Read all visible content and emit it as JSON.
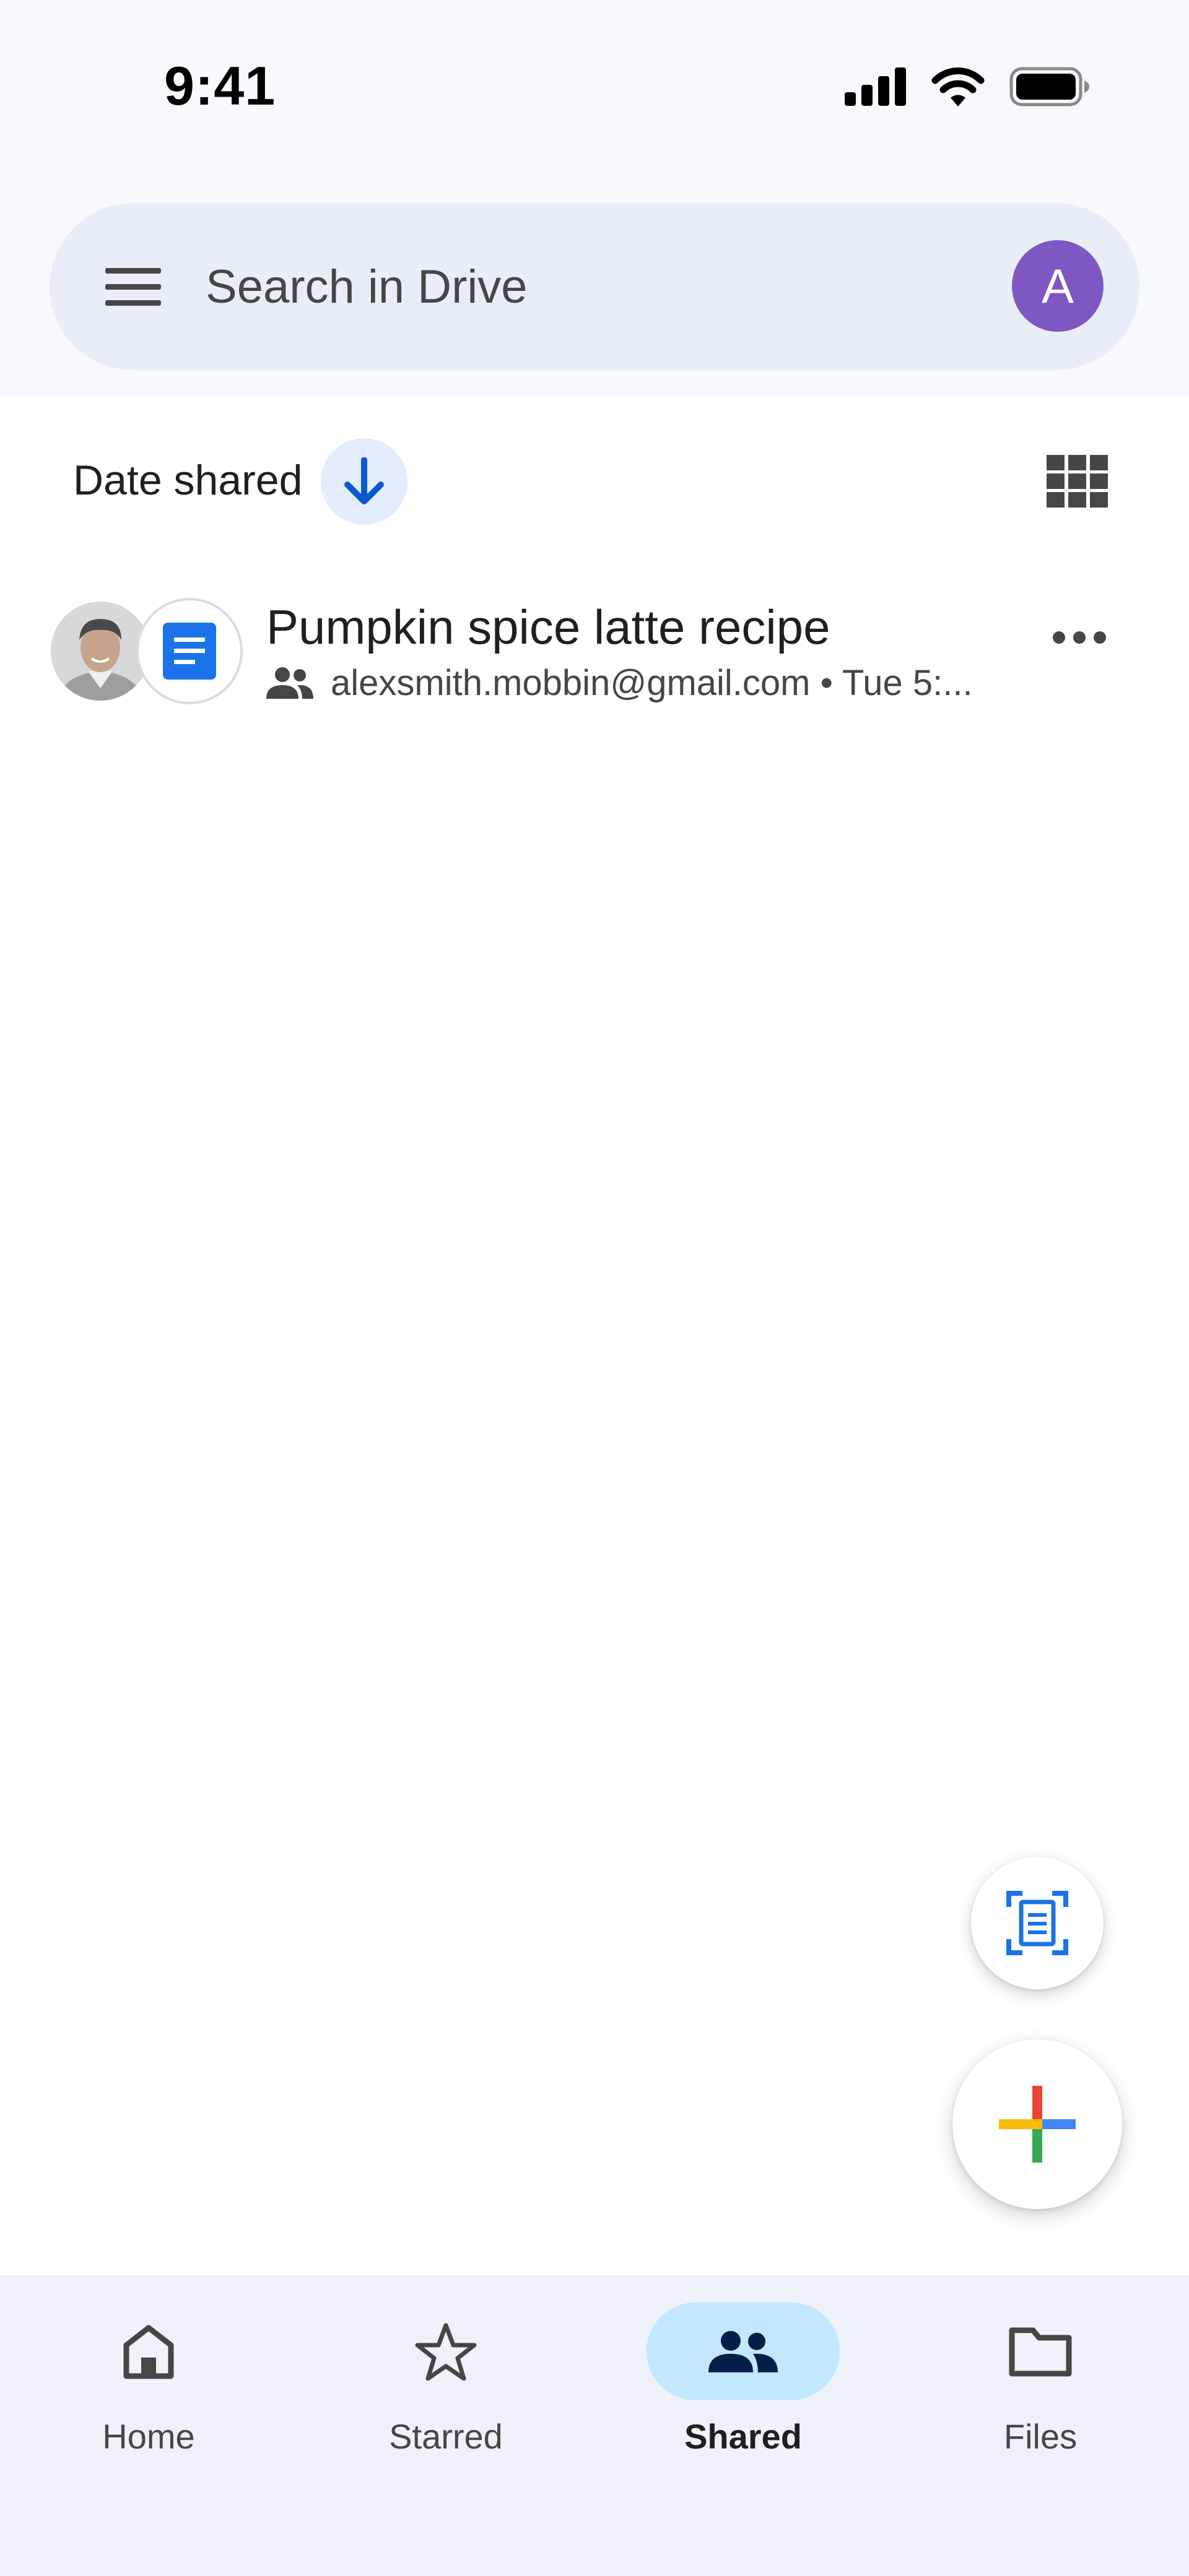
{
  "status_bar": {
    "time": "9:41",
    "icons": [
      "signal-icon",
      "wifi-icon",
      "battery-icon"
    ]
  },
  "search": {
    "placeholder": "Search in Drive",
    "avatar_letter": "A",
    "avatar_color": "#7e57c2"
  },
  "sort": {
    "label": "Date shared",
    "direction": "descending"
  },
  "files": [
    {
      "name": "Pumpkin spice latte recipe",
      "type": "google-docs",
      "owner": "alexsmith.mobbin@gmail.com",
      "shared_time": "Tue 5:...",
      "meta": "alexsmith.mobbin@gmail.com • Tue 5:..."
    }
  ],
  "bottom_nav": {
    "items": [
      {
        "label": "Home",
        "icon": "home-icon",
        "active": false
      },
      {
        "label": "Starred",
        "icon": "star-icon",
        "active": false
      },
      {
        "label": "Shared",
        "icon": "people-icon",
        "active": true
      },
      {
        "label": "Files",
        "icon": "folder-icon",
        "active": false
      }
    ]
  },
  "colors": {
    "accent": "#1a73e8",
    "nav_active_pill": "#c2e7ff",
    "search_bar_bg": "#e8eef7",
    "bottom_nav_bg": "#eef2fa"
  }
}
